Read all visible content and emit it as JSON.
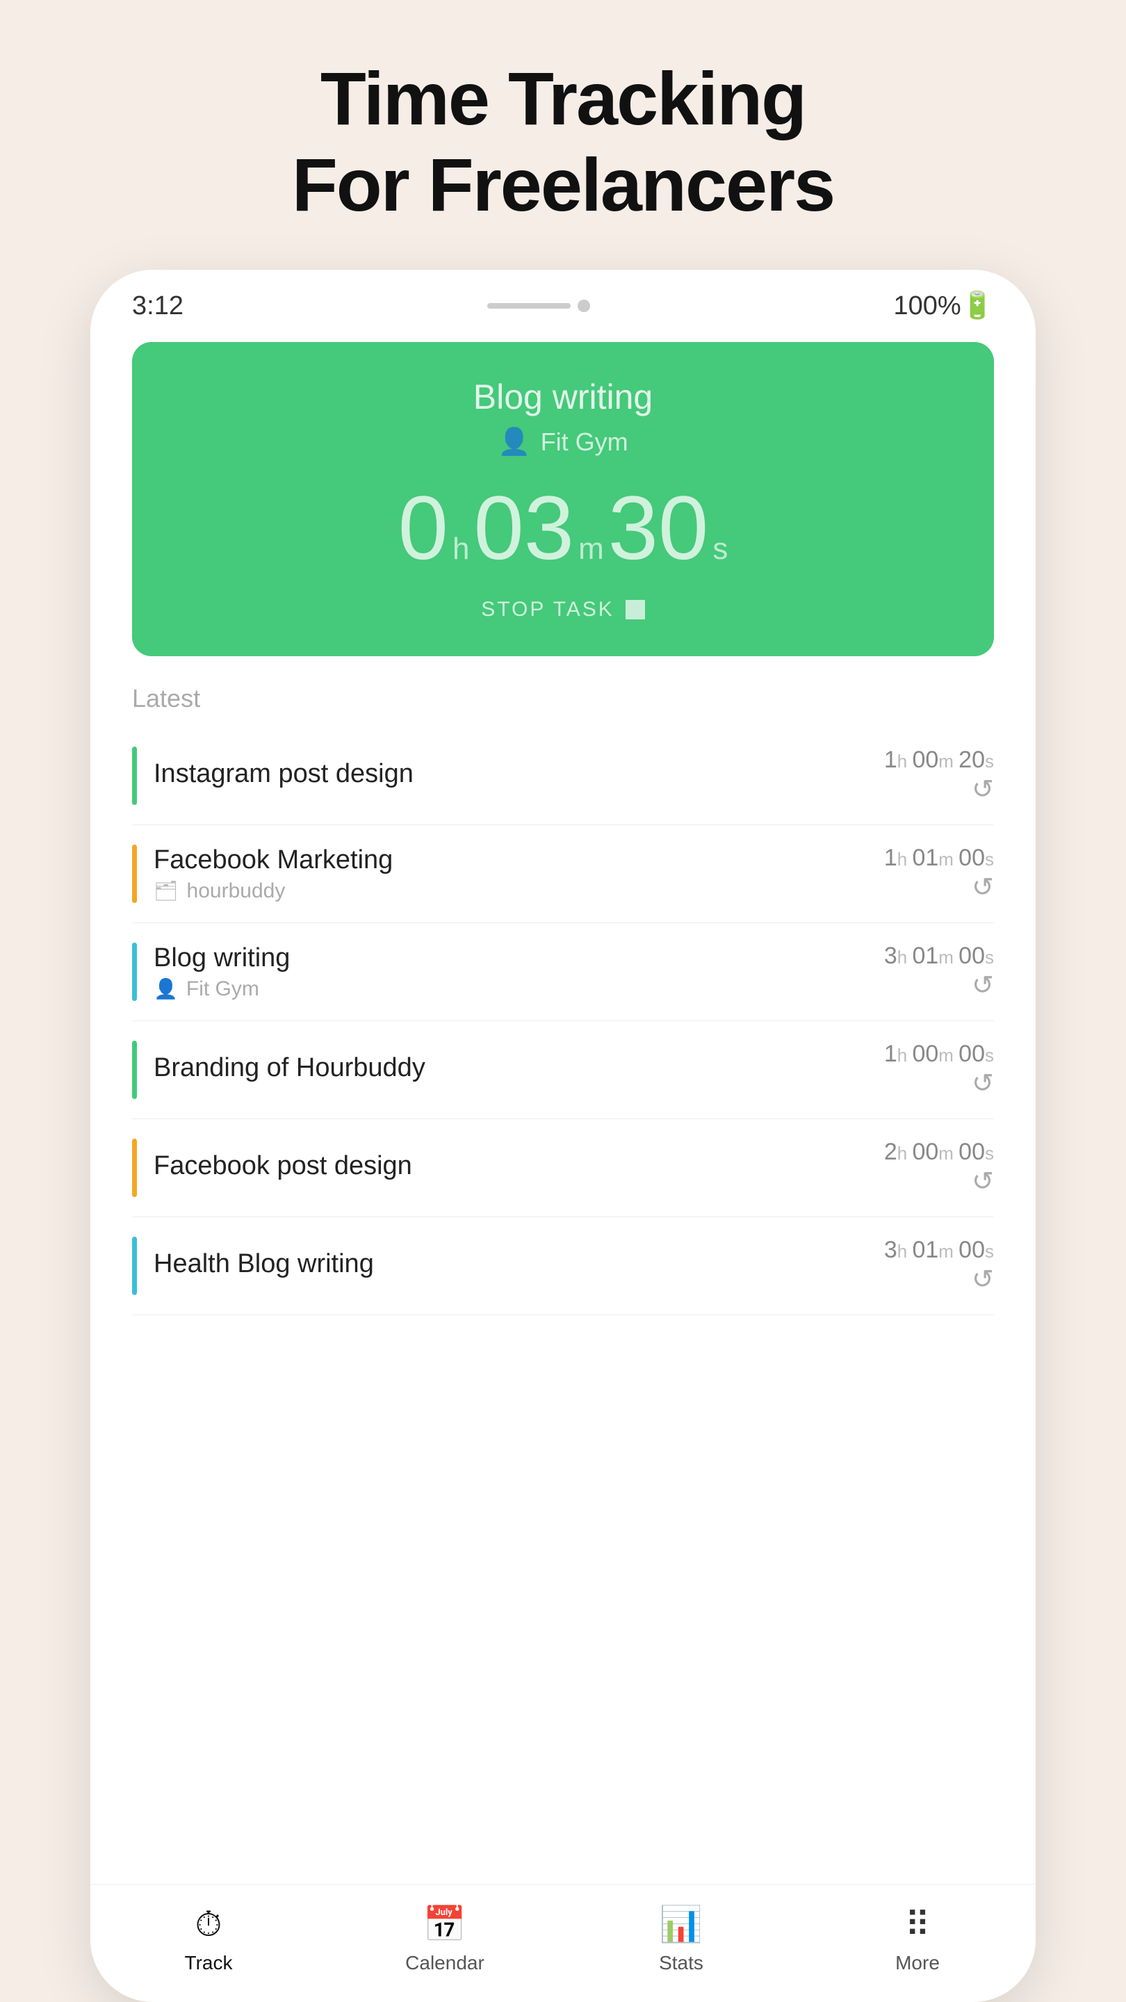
{
  "header": {
    "title_line1": "Time Tracking",
    "title_line2": "For Freelancers"
  },
  "status_bar": {
    "time": "3:12",
    "battery": "100%🔋"
  },
  "timer_card": {
    "task_name": "Blog writing",
    "client_name": "Fit Gym",
    "hours": "0",
    "hours_unit": "h",
    "minutes": "03",
    "minutes_unit": "m",
    "seconds": "30",
    "seconds_unit": "s",
    "stop_label": "STOP TASK",
    "bg_color": "#45c97a"
  },
  "latest_section": {
    "label": "Latest"
  },
  "tasks": [
    {
      "name": "Instagram post design",
      "client": "",
      "duration_h": "1",
      "duration_m": "00",
      "duration_s": "20",
      "color": "#45c97a",
      "has_client_icon": false
    },
    {
      "name": "Facebook Marketing",
      "client": "hourbuddy",
      "duration_h": "1",
      "duration_m": "01",
      "duration_s": "00",
      "color": "#f5a623",
      "has_client_icon": true
    },
    {
      "name": "Blog writing",
      "client": "Fit Gym",
      "duration_h": "3",
      "duration_m": "01",
      "duration_s": "00",
      "color": "#3bbfd8",
      "has_client_icon": true
    },
    {
      "name": "Branding of Hourbuddy",
      "client": "",
      "duration_h": "1",
      "duration_m": "00",
      "duration_s": "00",
      "color": "#45c97a",
      "has_client_icon": false
    },
    {
      "name": "Facebook post design",
      "client": "",
      "duration_h": "2",
      "duration_m": "00",
      "duration_s": "00",
      "color": "#f5a623",
      "has_client_icon": false
    },
    {
      "name": "Health Blog writing",
      "client": "",
      "duration_h": "3",
      "duration_m": "01",
      "duration_s": "00",
      "color": "#3bbfd8",
      "has_client_icon": false
    }
  ],
  "bottom_nav": {
    "items": [
      {
        "label": "Track",
        "icon": "⏱",
        "active": true
      },
      {
        "label": "Calendar",
        "icon": "📅",
        "active": false
      },
      {
        "label": "Stats",
        "icon": "📊",
        "active": false
      },
      {
        "label": "More",
        "icon": "⠿",
        "active": false
      }
    ]
  }
}
